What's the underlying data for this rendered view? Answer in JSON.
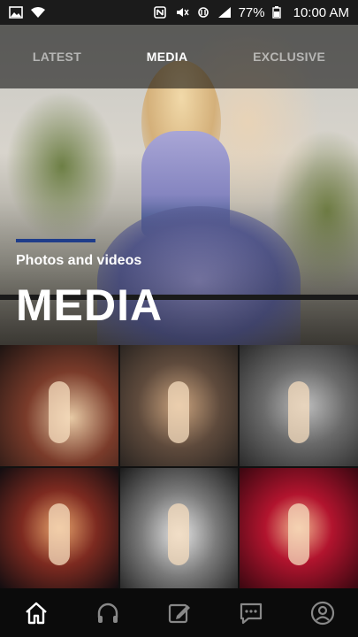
{
  "status_bar": {
    "battery": "77%",
    "time": "10:00 AM",
    "icons_left": [
      "image-icon",
      "wifi-icon"
    ],
    "icons_right": [
      "nfc-icon",
      "mute-icon",
      "data-icon",
      "signal-icon",
      "battery-icon"
    ]
  },
  "tabs": [
    {
      "label": "LATEST",
      "active": false
    },
    {
      "label": "MEDIA",
      "active": true
    },
    {
      "label": "EXCLUSIVE",
      "active": false
    }
  ],
  "hero": {
    "subtitle": "Photos and videos",
    "title": "MEDIA",
    "accent_color": "#1f3d8a"
  },
  "grid": {
    "items": [
      "photo-1",
      "photo-2",
      "photo-3",
      "photo-4",
      "photo-5",
      "photo-6"
    ]
  },
  "bottom_nav": {
    "items": [
      "home-icon",
      "headphones-icon",
      "edit-icon",
      "chat-icon",
      "profile-icon"
    ],
    "active": "home-icon"
  }
}
